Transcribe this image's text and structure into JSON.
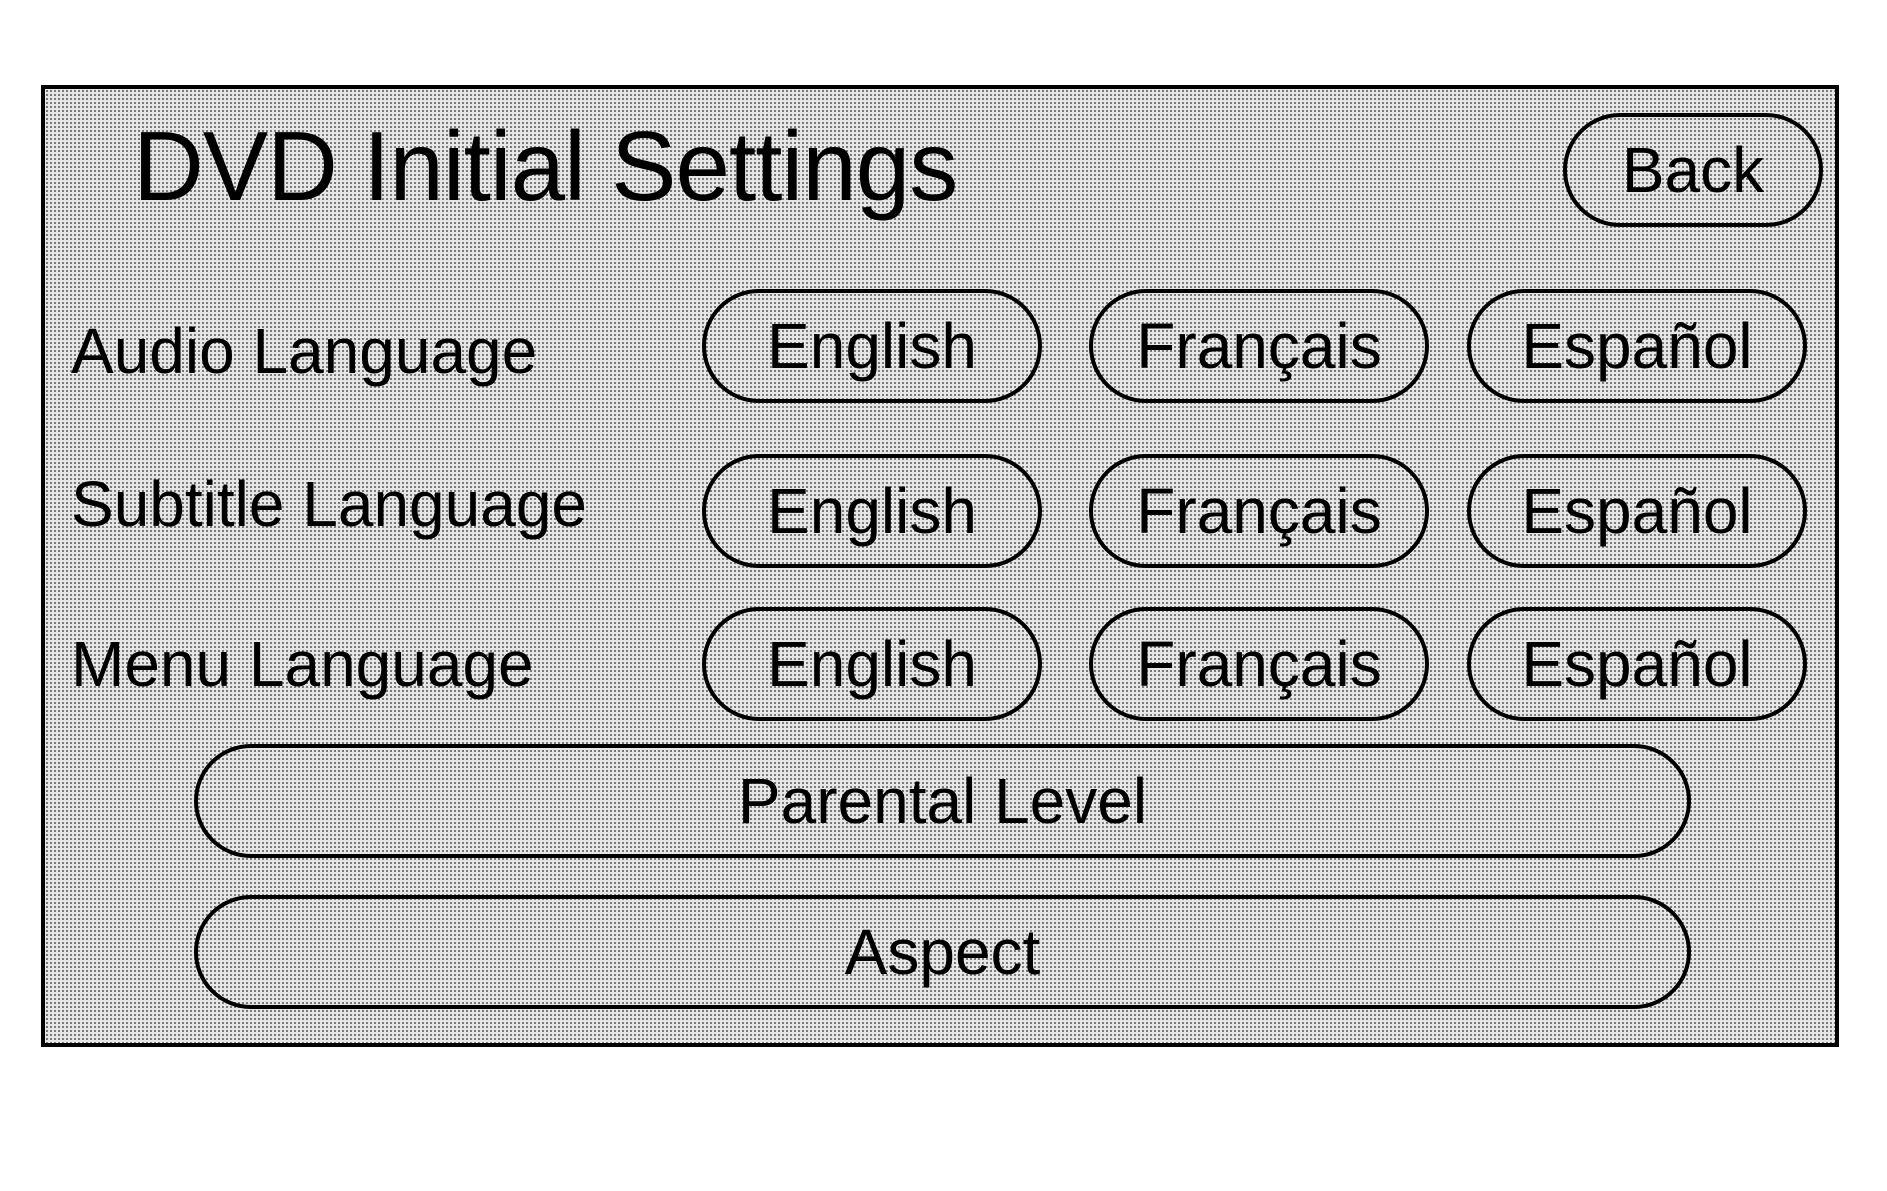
{
  "screen": {
    "title": "DVD Initial Settings",
    "back_label": "Back"
  },
  "settings": [
    {
      "label": "Audio Language",
      "options": [
        "English",
        "Français",
        "Español"
      ]
    },
    {
      "label": "Subtitle Language",
      "options": [
        "English",
        "Français",
        "Español"
      ]
    },
    {
      "label": "Menu Language",
      "options": [
        "English",
        "Français",
        "Español"
      ]
    }
  ],
  "actions": {
    "parental_level_label": "Parental Level",
    "aspect_label": "Aspect"
  }
}
